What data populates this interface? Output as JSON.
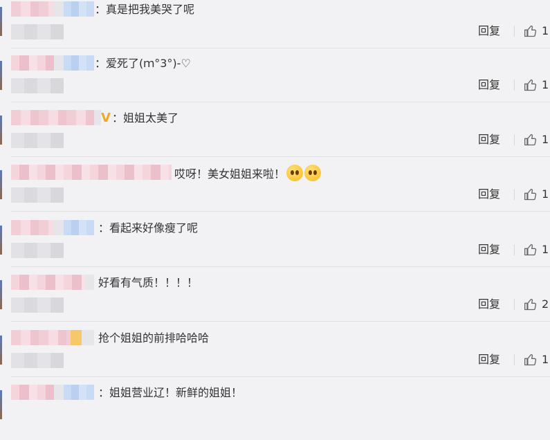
{
  "comments": [
    {
      "text": "：真是把我美哭了呢",
      "reply": "回复",
      "likes": "1"
    },
    {
      "text": "：爱死了(ｍ°3°)-♡",
      "reply": "回复",
      "likes": "1"
    },
    {
      "badge": "V",
      "text": "：姐姐太美了",
      "reply": "回复",
      "likes": "1"
    },
    {
      "text": "哎呀！美女姐姐来啦！",
      "reply": "回复",
      "likes": "1"
    },
    {
      "text": "：看起来好像瘦了呢",
      "reply": "回复",
      "likes": "1"
    },
    {
      "text": "好看有气质！！！！",
      "reply": "回复",
      "likes": "2"
    },
    {
      "text": "抢个姐姐的前排哈哈哈",
      "reply": "回复",
      "likes": "1"
    },
    {
      "text": "：姐姐营业辽！新鲜的姐姐！",
      "reply": "回复",
      "likes": ""
    }
  ],
  "icons": {
    "like": "thumbs-up-icon",
    "badge": "verified-v-icon",
    "emoji": "surprised-face-icon"
  },
  "colors": {
    "background": "#f2f2f5",
    "badge": "#f5a623",
    "text": "#333333"
  }
}
